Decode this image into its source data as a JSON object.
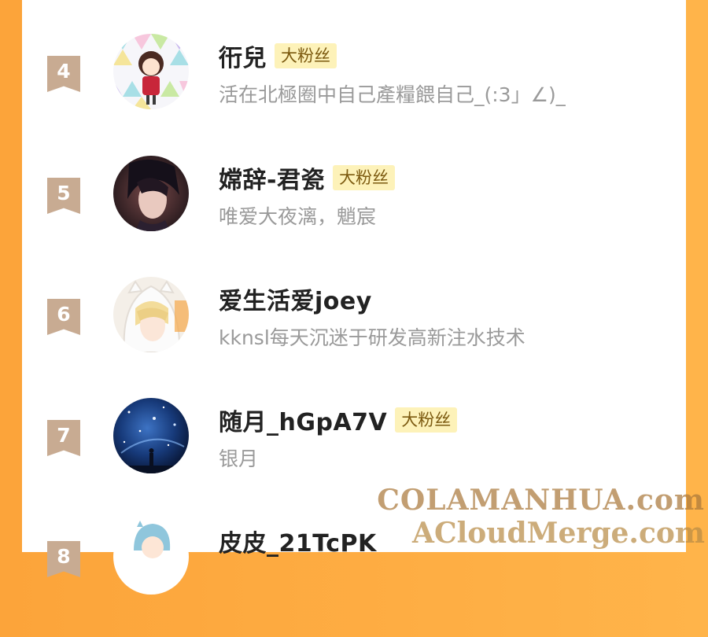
{
  "fans": [
    {
      "rank": "4",
      "name": "衎兒",
      "badge": "大粉丝",
      "sign": "活在北極圈中自己產糧餵自己_(:3」∠)_",
      "avatar_desc": "chibi-girl-avatar"
    },
    {
      "rank": "5",
      "name": "嫦辞-君瓷",
      "badge": "大粉丝",
      "sign": "唯爱大夜漓，魈宸",
      "avatar_desc": "dark-haired-man-avatar"
    },
    {
      "rank": "6",
      "name": "爱生活爱joey",
      "badge": "",
      "sign": "kknsl每天沉迷于研发高新注水技术",
      "avatar_desc": "blonde-hoodie-avatar"
    },
    {
      "rank": "7",
      "name": "随月_hGpA7V",
      "badge": "大粉丝",
      "sign": "银月",
      "avatar_desc": "starry-sky-avatar"
    },
    {
      "rank": "8",
      "name": "皮皮_21TcPK",
      "badge": "",
      "sign": "",
      "avatar_desc": "chibi-hood-avatar"
    }
  ],
  "watermark": {
    "line1": "COLAMANHUA.com",
    "line2": "ACloudMerge.com"
  },
  "colors": {
    "background": "#fca43a",
    "rank_badge": "#c8ab92",
    "fan_badge_bg": "#fdf2b9"
  }
}
